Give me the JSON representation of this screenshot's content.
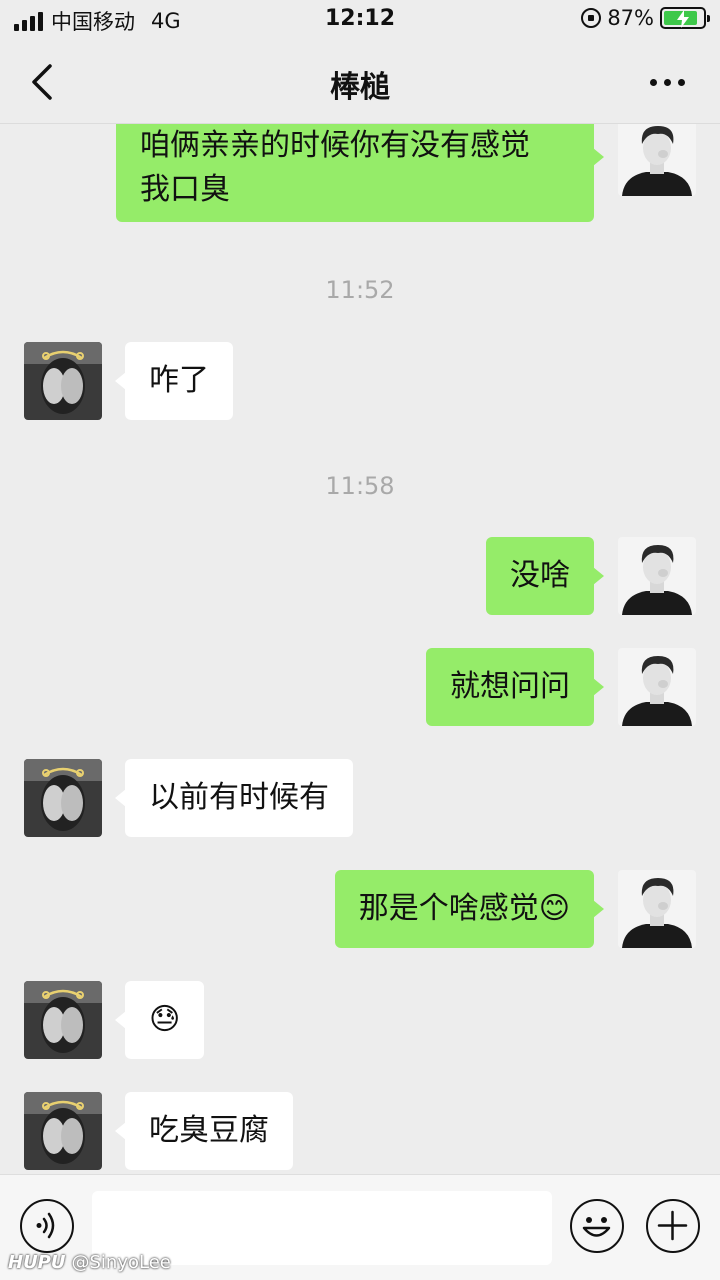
{
  "status_bar": {
    "carrier": "中国移动",
    "network": "4G",
    "time": "12:12",
    "battery_percent": "87%",
    "battery_level": 0.87,
    "signal_bars": 4
  },
  "header": {
    "title": "棒槌",
    "back_icon": "chevron-left-icon",
    "more_icon": "more-dots-icon"
  },
  "messages": [
    {
      "side": "me",
      "text": "咱俩亲亲的时候你有没有感觉\n我口臭"
    },
    {
      "timestamp": "11:52"
    },
    {
      "side": "them",
      "text": "咋了"
    },
    {
      "timestamp": "11:58"
    },
    {
      "side": "me",
      "text": "没啥"
    },
    {
      "side": "me",
      "text": "就想问问"
    },
    {
      "side": "them",
      "text": "以前有时候有"
    },
    {
      "side": "me",
      "text": "那是个啥感觉😊"
    },
    {
      "side": "them",
      "text": "😓"
    },
    {
      "side": "them",
      "text": "吃臭豆腐"
    }
  ],
  "input_bar": {
    "voice_icon": "voice-icon",
    "emoji_icon": "emoji-icon",
    "plus_icon": "plus-icon",
    "input_value": ""
  },
  "watermark": {
    "brand": "HUPU",
    "user": "@SinyoLee"
  },
  "colors": {
    "my_bubble": "#95ec69",
    "their_bubble": "#ffffff",
    "background": "#ededed",
    "battery": "#3ec84a"
  }
}
